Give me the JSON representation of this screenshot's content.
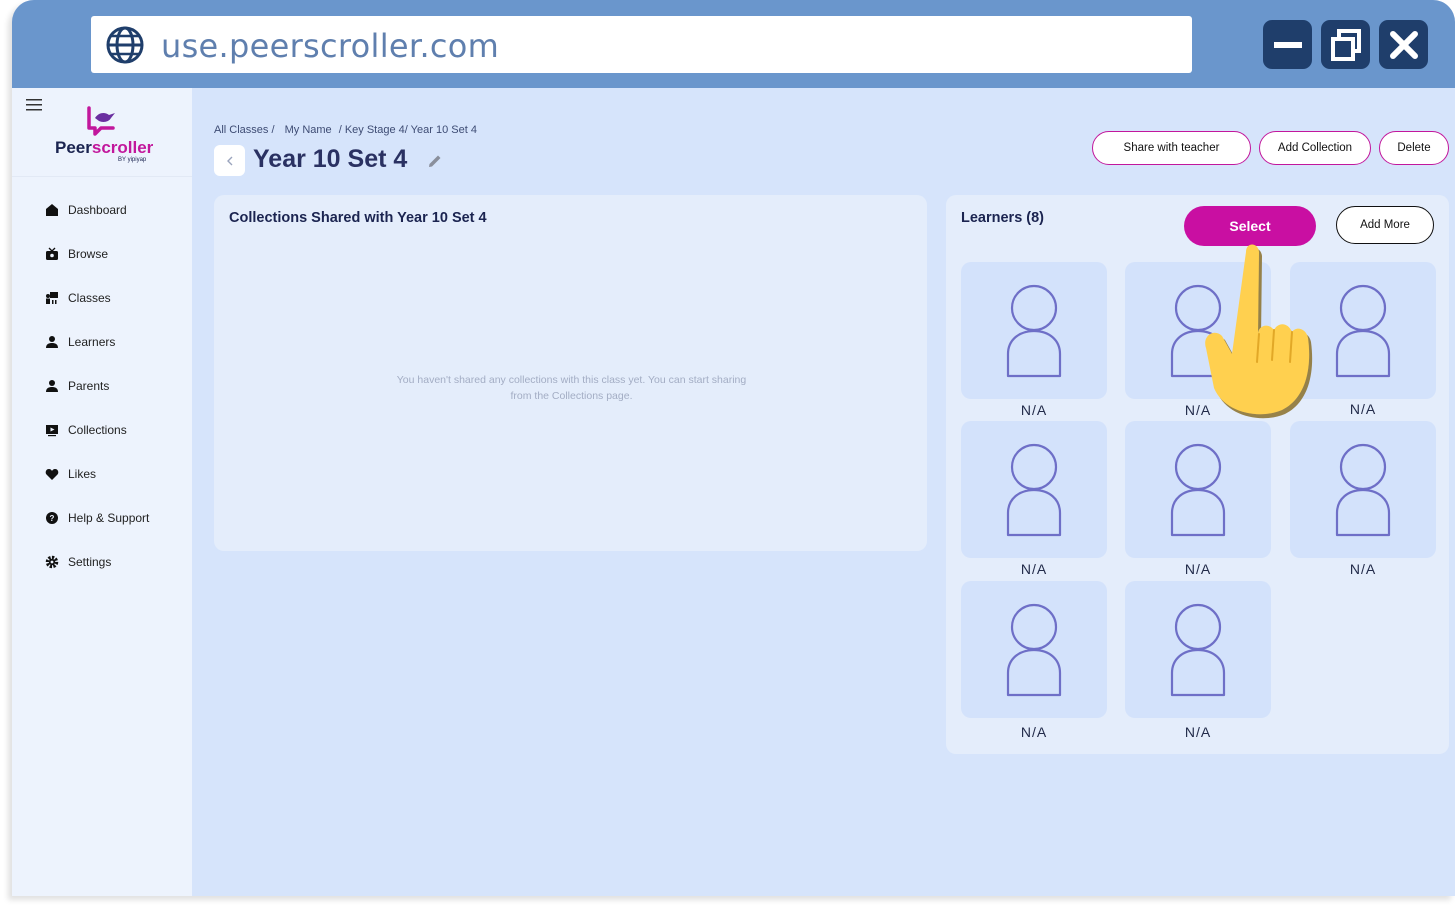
{
  "browser": {
    "url": "use.peerscroller.com",
    "minimize_icon": "minimize-icon",
    "restore_icon": "restore-icon",
    "close_icon": "close-icon"
  },
  "sidebar": {
    "logo": {
      "part1": "Peer",
      "part2": "scroller",
      "sub": "BY yipiyap"
    },
    "items": [
      {
        "label": "Dashboard",
        "icon": "home-icon"
      },
      {
        "label": "Browse",
        "icon": "tv-icon"
      },
      {
        "label": "Classes",
        "icon": "classroom-icon"
      },
      {
        "label": "Learners",
        "icon": "person-icon"
      },
      {
        "label": "Parents",
        "icon": "person-icon"
      },
      {
        "label": "Collections",
        "icon": "play-icon"
      },
      {
        "label": "Likes",
        "icon": "heart-icon"
      },
      {
        "label": "Help & Support",
        "icon": "help-icon"
      },
      {
        "label": "Settings",
        "icon": "gear-icon"
      }
    ]
  },
  "breadcrumb": [
    "All Classes /",
    "My Name",
    "/ Key Stage 4/ Year 10 Set 4"
  ],
  "page": {
    "title": "Year 10 Set 4",
    "actions": {
      "share": "Share with teacher",
      "add_collection": "Add Collection",
      "delete": "Delete"
    }
  },
  "collections": {
    "title": "Collections Shared with Year 10 Set 4",
    "empty_message": "You haven't shared any collections with this class yet. You can start sharing from the Collections page."
  },
  "learners": {
    "title": "Learners (8)",
    "select_label": "Select",
    "add_more_label": "Add More",
    "items": [
      "N/A",
      "N/A",
      "N/A",
      "N/A",
      "N/A",
      "N/A",
      "N/A",
      "N/A"
    ]
  },
  "colors": {
    "accent": "#c90fa2",
    "titlebar": "#6a96cc",
    "window_button": "#1f3e6b",
    "background": "#d6e4fb"
  }
}
